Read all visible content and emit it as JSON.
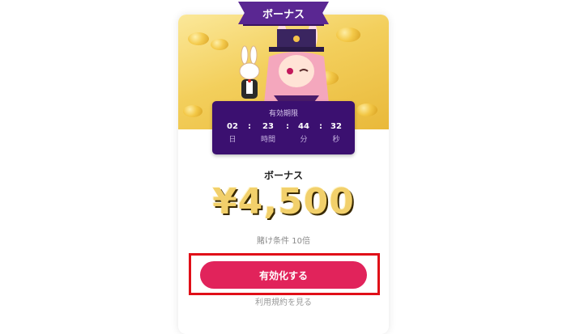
{
  "ribbon": {
    "label": "ボーナス"
  },
  "timer": {
    "title": "有効期限",
    "days": "02",
    "days_label": "日",
    "hours": "23",
    "hours_label": "時間",
    "minutes": "44",
    "minutes_label": "分",
    "seconds": "32",
    "seconds_label": "秒",
    "separator": ":"
  },
  "bonus": {
    "label": "ボーナス",
    "amount": "¥4,500",
    "wagering": "賭け条件 10倍"
  },
  "actions": {
    "activate_label": "有効化する",
    "terms_label": "利用規約を見る"
  },
  "colors": {
    "ribbon": "#5a2792",
    "timer_bg": "#3b1070",
    "button": "#e1235b",
    "highlight_border": "#e00f18",
    "amount_gold": "#f2d06b"
  }
}
